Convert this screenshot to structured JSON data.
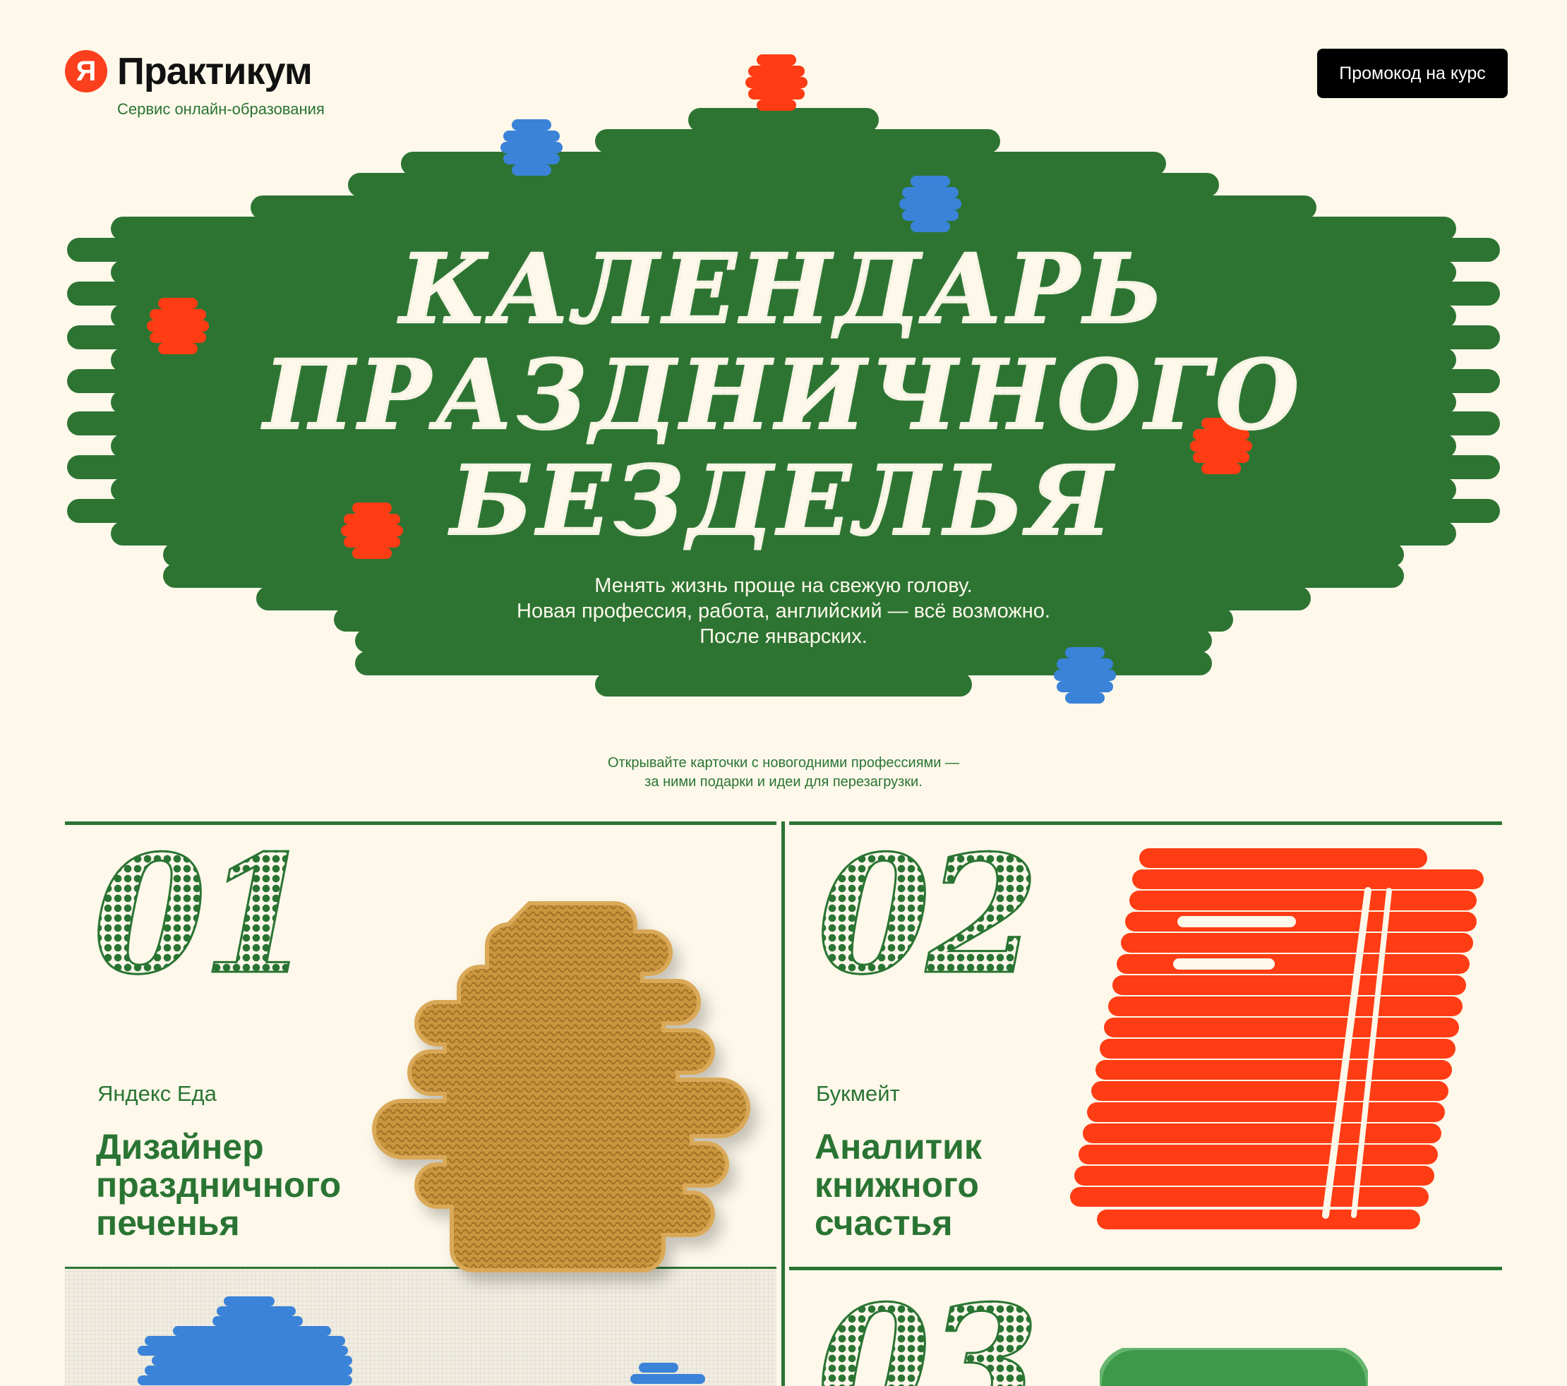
{
  "header": {
    "logo_letter": "Я",
    "logo_word": "Практикум",
    "tagline": "Сервис онлайн-образования",
    "promo_button": "Промокод на курс"
  },
  "hero": {
    "title_line1": "КАЛЕНДАРЬ",
    "title_line2": "ПРАЗДНИЧНОГО",
    "title_line3": "БЕЗДЕЛЬЯ",
    "lead_line1": "Менять жизнь проще на свежую голову.",
    "lead_line2": "Новая профессия, работа, английский — всё возможно.",
    "lead_line3": "После январских."
  },
  "hint": {
    "line1": "Открывайте карточки с новогодними профессиями —",
    "line2": "за ними подарки и идеи для перезагрузки."
  },
  "cards": [
    {
      "number": "01",
      "brand": "Яндекс Еда",
      "title": "Дизайнер праздничного печенья",
      "image": "knitted-cookie-tree"
    },
    {
      "number": "02",
      "brand": "Букмейт",
      "title": "Аналитик книжного счастья",
      "image": "knitted-red-book"
    },
    {
      "number": "03",
      "brand": "",
      "title": "",
      "image": "knitted-green-object"
    }
  ],
  "colors": {
    "green": "#2a7433",
    "cream": "#fdf8ea",
    "red": "#ff3c14",
    "blue": "#3a83d8",
    "cookie": "#c9953c"
  }
}
